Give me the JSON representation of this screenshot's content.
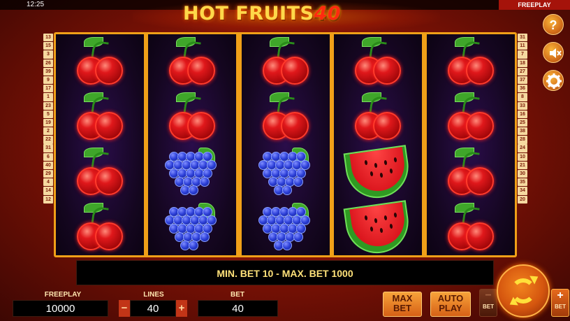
{
  "status_bar": {
    "time": "12:25",
    "mode": "FREEPLAY"
  },
  "logo": {
    "text": "HOT FRUITS",
    "number": "40"
  },
  "reels": [
    [
      "cherry",
      "cherry",
      "cherry",
      "cherry"
    ],
    [
      "cherry",
      "cherry",
      "grapes",
      "grapes"
    ],
    [
      "cherry",
      "cherry",
      "grapes",
      "grapes"
    ],
    [
      "cherry",
      "cherry",
      "watermelon",
      "watermelon"
    ],
    [
      "cherry",
      "cherry",
      "cherry",
      "cherry"
    ]
  ],
  "paylines_left": [
    "13",
    "15",
    "3",
    "26",
    "39",
    "9",
    "17",
    "1",
    "23",
    "5",
    "19",
    "2",
    "22",
    "31",
    "6",
    "40",
    "29",
    "4",
    "14",
    "12"
  ],
  "paylines_right": [
    "31",
    "11",
    "7",
    "18",
    "27",
    "37",
    "36",
    "8",
    "33",
    "16",
    "25",
    "38",
    "28",
    "24",
    "10",
    "21",
    "30",
    "35",
    "34",
    "20"
  ],
  "info": {
    "message": "MIN. BET 10 - MAX. BET 1000"
  },
  "side_buttons": {
    "help": "?",
    "sound": "sound-muted-icon",
    "settings": "gear-icon"
  },
  "controls": {
    "freeplay_label": "FREEPLAY",
    "freeplay_value": "10000",
    "lines_label": "LINES",
    "lines_value": "40",
    "lines_minus": "−",
    "lines_plus": "+",
    "bet_label": "BET",
    "bet_value": "40",
    "max_bet_line1": "MAX",
    "max_bet_line2": "BET",
    "auto_play_line1": "AUTO",
    "auto_play_line2": "PLAY",
    "bet_minus_sign": "−",
    "bet_minus_text": "BET",
    "bet_plus_sign": "+",
    "bet_plus_text": "BET"
  },
  "colors": {
    "frame": "#f0a018",
    "accent": "#ffe27a",
    "background": "#8a1406"
  }
}
